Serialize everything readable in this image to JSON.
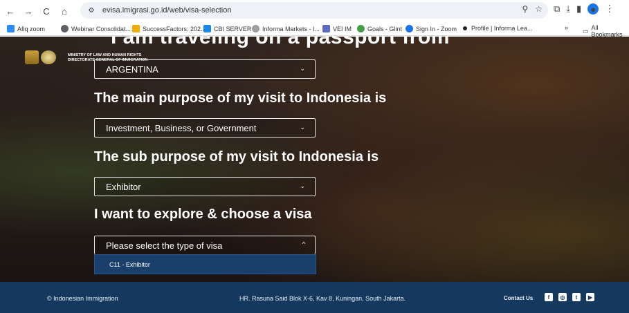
{
  "browser": {
    "url": "evisa.imigrasi.go.id/web/visa-selection",
    "bookmarks": [
      {
        "label": "Afiq zoom",
        "color": "#2d8cff"
      },
      {
        "label": "Webinar Consolidat...",
        "color": "#5f6368"
      },
      {
        "label": "SuccessFactors: 202...",
        "color": "#f0ab00"
      },
      {
        "label": "CBI SERVER",
        "color": "#1e88e5"
      },
      {
        "label": "Informa Markets - I...",
        "color": "#9e9e9e"
      },
      {
        "label": "VEI IM",
        "color": "#5c6bc0"
      },
      {
        "label": "Goals - Glint",
        "color": "#43a047"
      },
      {
        "label": "Sign In - Zoom",
        "color": "#1a73e8"
      },
      {
        "label": "Profile | Informa Lea...",
        "color": "#222222"
      }
    ],
    "all_bookmarks": "All Bookmarks",
    "more": "»"
  },
  "site": {
    "ministry_line1": "MINISTRY OF LAW AND HUMAN RIGHTS",
    "ministry_line2": "DIRECTORATE GENERAL OF IMMIGRATION",
    "cropped_heading": "I am traveling on a passport from"
  },
  "form": {
    "passport_value": "ARGENTINA",
    "purpose_heading": "The main purpose of my visit to Indonesia is",
    "purpose_value": "Investment, Business, or Government",
    "sub_heading": "The sub purpose of my visit to Indonesia is",
    "sub_value": "Exhibitor",
    "visa_heading": "I want to explore & choose a visa",
    "visa_placeholder": "Please select the type of visa",
    "visa_options": [
      "C11 - Exhibitor"
    ]
  },
  "footer": {
    "copyright": "© Indonesian Immigration",
    "address": "HR. Rasuna Said Blok X-6, Kav 8, Kuningan, South Jakarta.",
    "contact": "Contact Us",
    "socials": [
      "facebook-icon",
      "instagram-icon",
      "twitter-icon",
      "youtube-icon"
    ]
  }
}
